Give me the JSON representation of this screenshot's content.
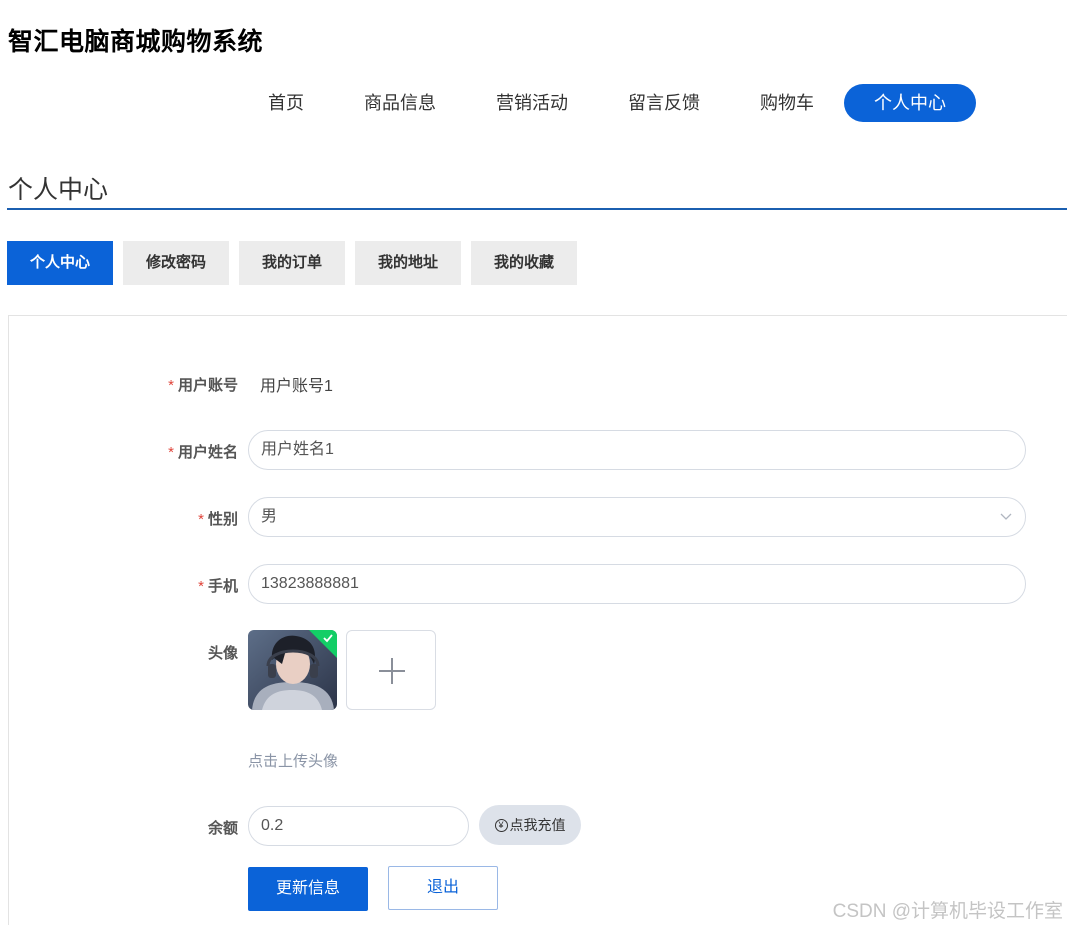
{
  "site_title": "智汇电脑商城购物系统",
  "nav": {
    "items": [
      {
        "label": "首页"
      },
      {
        "label": "商品信息"
      },
      {
        "label": "营销活动"
      },
      {
        "label": "留言反馈"
      },
      {
        "label": "购物车"
      },
      {
        "label": "个人中心",
        "active": true
      }
    ]
  },
  "section_title": "个人中心",
  "tabs": [
    {
      "label": "个人中心",
      "active": true
    },
    {
      "label": "修改密码"
    },
    {
      "label": "我的订单"
    },
    {
      "label": "我的地址"
    },
    {
      "label": "我的收藏"
    }
  ],
  "form": {
    "account": {
      "label": "用户账号",
      "required": "*",
      "value": "用户账号1"
    },
    "name": {
      "label": "用户姓名",
      "required": "*",
      "value": "用户姓名1"
    },
    "gender": {
      "label": "性别",
      "required": "*",
      "value": "男"
    },
    "phone": {
      "label": "手机",
      "required": "*",
      "value": "13823888881"
    },
    "avatar": {
      "label": "头像",
      "upload_hint": "点击上传头像"
    },
    "balance": {
      "label": "余额",
      "value": "0.2",
      "recharge_label": "点我充值",
      "recharge_icon": "yen-circle-icon",
      "yen_glyph": "¥"
    }
  },
  "actions": {
    "update_label": "更新信息",
    "logout_label": "退出"
  },
  "watermark": "CSDN @计算机毕设工作室",
  "colors": {
    "primary": "#0b63d8",
    "required": "#e0443a",
    "tab_inactive": "#ececec",
    "success_badge": "#13ce66"
  }
}
